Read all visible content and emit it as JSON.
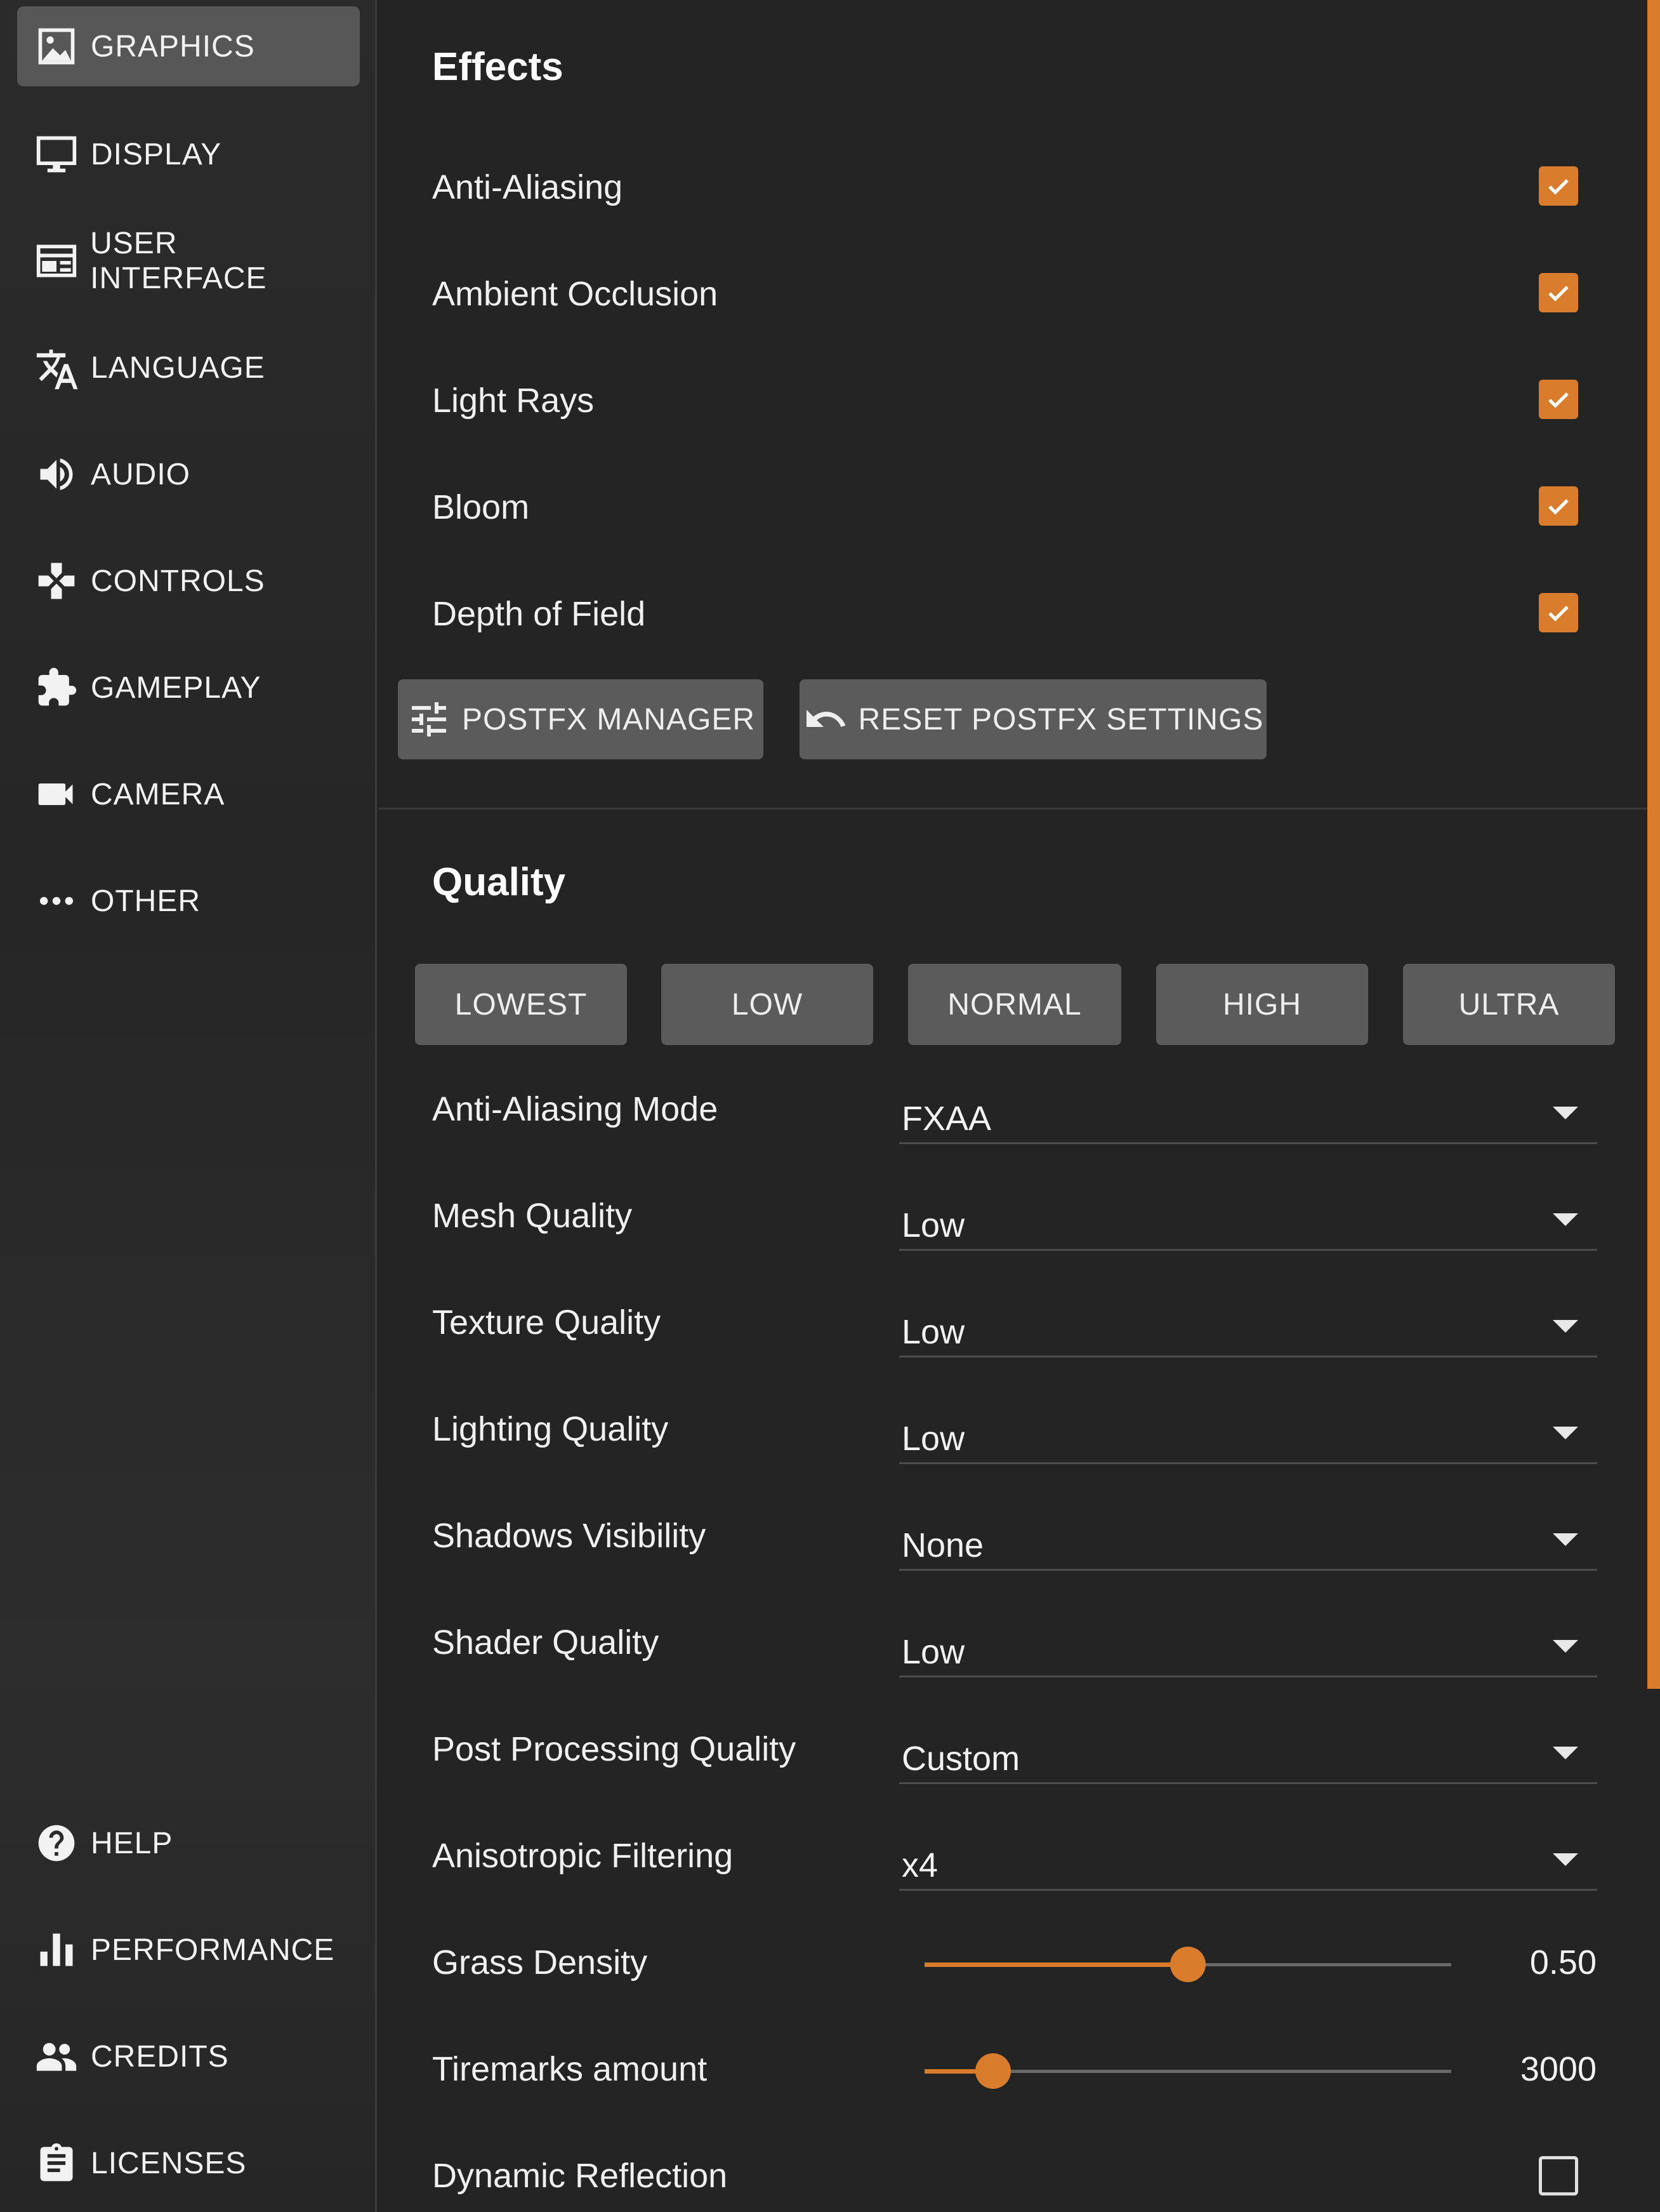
{
  "sidebar": {
    "items": [
      {
        "label": "GRAPHICS",
        "icon": "image-icon",
        "active": true
      },
      {
        "label": "DISPLAY",
        "icon": "monitor-icon"
      },
      {
        "label": "USER INTERFACE",
        "icon": "web-window-icon"
      },
      {
        "label": "LANGUAGE",
        "icon": "translate-icon"
      },
      {
        "label": "AUDIO",
        "icon": "speaker-icon"
      },
      {
        "label": "CONTROLS",
        "icon": "gamepad-icon"
      },
      {
        "label": "GAMEPLAY",
        "icon": "puzzle-icon"
      },
      {
        "label": "CAMERA",
        "icon": "video-camera-icon"
      },
      {
        "label": "OTHER",
        "icon": "more-dots-icon"
      }
    ],
    "bottom_items": [
      {
        "label": "HELP",
        "icon": "help-circle-icon"
      },
      {
        "label": "PERFORMANCE",
        "icon": "bar-chart-icon"
      },
      {
        "label": "CREDITS",
        "icon": "people-icon"
      },
      {
        "label": "LICENSES",
        "icon": "clipboard-icon"
      }
    ]
  },
  "effects": {
    "title": "Effects",
    "rows": [
      {
        "label": "Anti-Aliasing",
        "checked": true
      },
      {
        "label": "Ambient Occlusion",
        "checked": true
      },
      {
        "label": "Light Rays",
        "checked": true
      },
      {
        "label": "Bloom",
        "checked": true
      },
      {
        "label": "Depth of Field",
        "checked": true
      }
    ],
    "postfx_manager_label": "POSTFX MANAGER",
    "reset_postfx_label": "RESET POSTFX SETTINGS"
  },
  "quality": {
    "title": "Quality",
    "presets": [
      "LOWEST",
      "LOW",
      "NORMAL",
      "HIGH",
      "ULTRA"
    ],
    "selects": [
      {
        "label": "Anti-Aliasing Mode",
        "value": "FXAA"
      },
      {
        "label": "Mesh Quality",
        "value": "Low"
      },
      {
        "label": "Texture Quality",
        "value": "Low"
      },
      {
        "label": "Lighting Quality",
        "value": "Low"
      },
      {
        "label": "Shadows Visibility",
        "value": "None"
      },
      {
        "label": "Shader Quality",
        "value": "Low"
      },
      {
        "label": "Post Processing Quality",
        "value": "Custom"
      },
      {
        "label": "Anisotropic Filtering",
        "value": "x4"
      }
    ],
    "sliders": [
      {
        "label": "Grass Density",
        "value": "0.50",
        "fraction": 0.5
      },
      {
        "label": "Tiremarks amount",
        "value": "3000",
        "fraction": 0.13
      }
    ],
    "dynamic_reflection": {
      "label": "Dynamic Reflection",
      "checked": false
    }
  },
  "colors": {
    "accent": "#d97c2b",
    "background": "#242424",
    "button": "#5b5b5b"
  }
}
